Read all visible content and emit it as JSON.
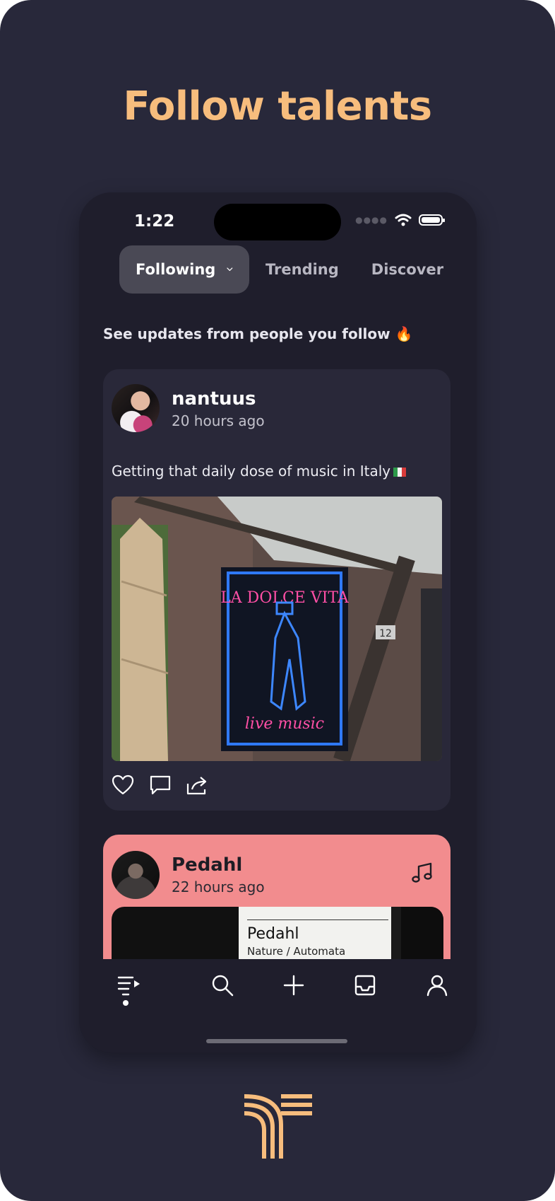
{
  "headline": "Follow talents",
  "status": {
    "time": "1:22"
  },
  "tabs": [
    {
      "label": "Following",
      "active": true
    },
    {
      "label": "Trending",
      "active": false
    },
    {
      "label": "Discover",
      "active": false
    }
  ],
  "feed_subtitle": "See updates from people you follow 🔥",
  "posts": [
    {
      "username": "nantuus",
      "time": "20 hours ago",
      "caption": "Getting that daily dose of music in Italy",
      "image": {
        "neon_title": "LA DOLCE VITA",
        "neon_subtitle": "live music",
        "sign_number": "12"
      },
      "actions": [
        "heart-icon",
        "comment-icon",
        "share-icon"
      ]
    },
    {
      "username": "Pedahl",
      "time": "22 hours ago",
      "album_title": "Pedahl",
      "album_subtitle": "Nature / Automata",
      "icon": "music-note-icon",
      "card_color": "#f28c8e"
    }
  ],
  "nav": [
    "feed-icon",
    "search-icon",
    "add-icon",
    "inbox-icon",
    "profile-icon"
  ],
  "colors": {
    "accent": "#f7bd7d",
    "background": "#28283a",
    "phone": "#1f1e2c",
    "card": "#292839"
  }
}
